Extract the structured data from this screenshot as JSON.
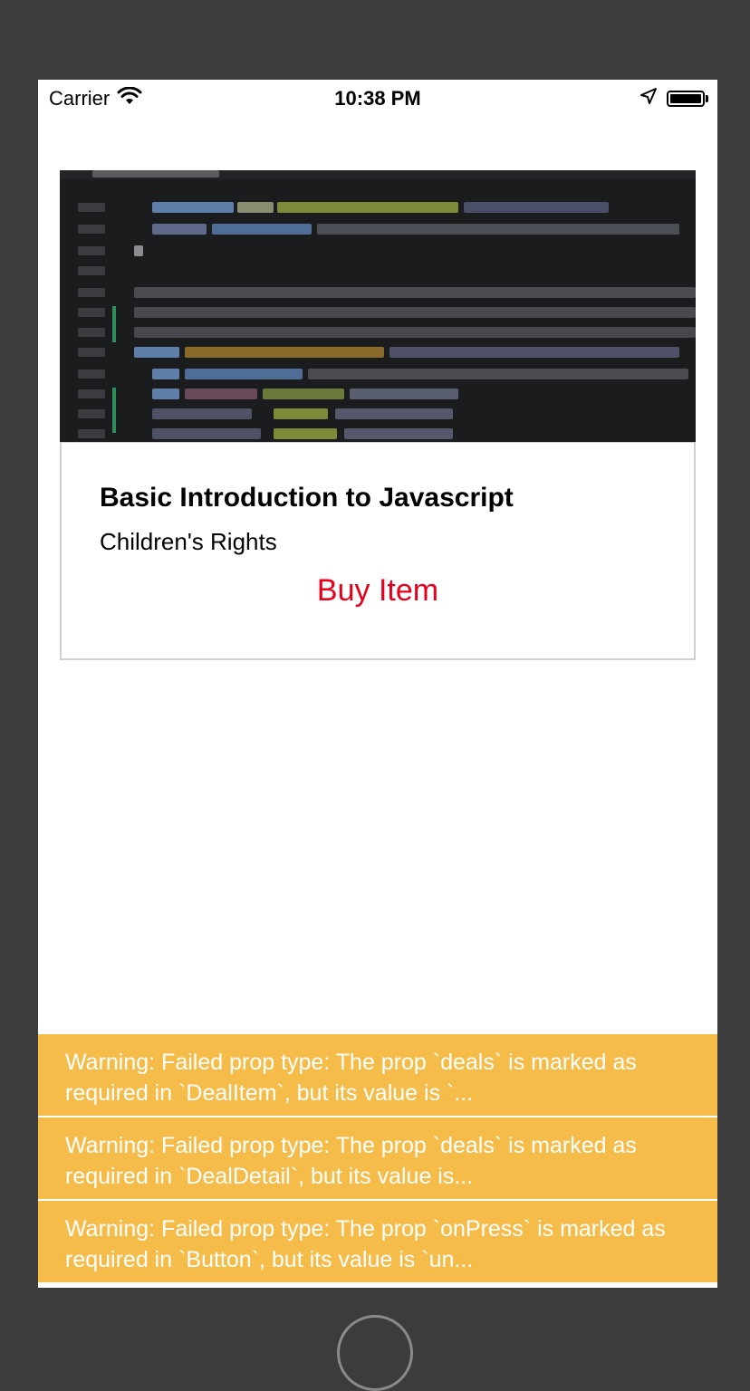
{
  "status_bar": {
    "carrier": "Carrier",
    "time": "10:38 PM",
    "icons": [
      "wifi-icon",
      "location-arrow-icon",
      "battery-icon"
    ]
  },
  "card": {
    "image_alt_icon": "code-screenshot-image",
    "title": "Basic Introduction to Javascript",
    "subtitle": "Children's Rights",
    "buy_label": "Buy Item",
    "buy_color": "#e8001c"
  },
  "warnings": [
    {
      "text": "Warning: Failed prop type: The prop `deals` is marked as required in `DealItem`, but its value is `..."
    },
    {
      "text": "Warning: Failed prop type: The prop `deals` is marked as required in `DealDetail`, but its value is..."
    },
    {
      "text": "Warning: Failed prop type: The prop `onPress` is marked as required in `Button`, but its value is `un..."
    }
  ],
  "colors": {
    "background": "#3c3c3c",
    "warning_bg": "#f5bc4a",
    "warning_text": "#ffffff"
  }
}
